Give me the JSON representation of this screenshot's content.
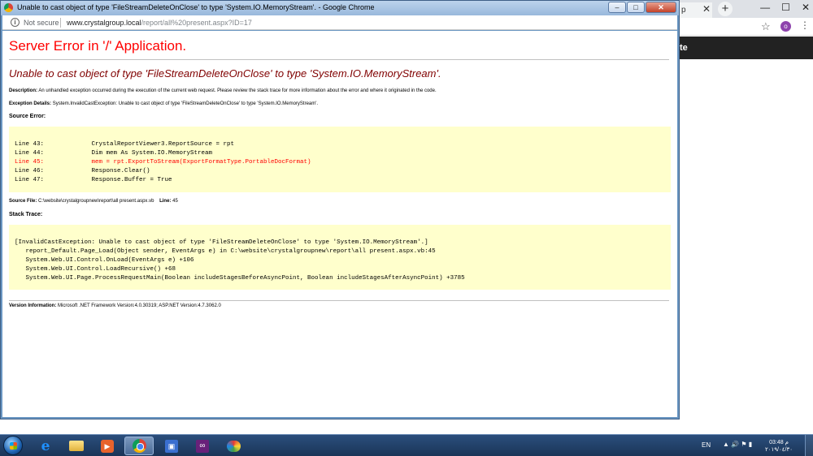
{
  "window": {
    "title": "Unable to cast object of type 'FileStreamDeleteOnClose' to type 'System.IO.MemoryStream'. - Google Chrome",
    "minimize_glyph": "–",
    "maximize_glyph": "□",
    "close_glyph": "✕"
  },
  "address_bar": {
    "security_label": "Not secure",
    "url_host": "www.crystalgroup.local",
    "url_path": "/report/all%20present.aspx?ID=17"
  },
  "background_window": {
    "tab_partial_text": "p",
    "dark_bar_text": "te",
    "profile_initial": "o"
  },
  "error_page": {
    "heading": "Server Error in '/' Application.",
    "subheading": "Unable to cast object of type 'FileStreamDeleteOnClose' to type 'System.IO.MemoryStream'.",
    "description_label": "Description:",
    "description_text": "An unhandled exception occurred during the execution of the current web request. Please review the stack trace for more information about the error and where it originated in the code.",
    "exception_label": "Exception Details:",
    "exception_text": "System.InvalidCastException: Unable to cast object of type 'FileStreamDeleteOnClose' to type 'System.IO.MemoryStream'.",
    "source_error_label": "Source Error:",
    "source_lines": [
      {
        "text": "Line 43:             CrystalReportViewer3.ReportSource = rpt",
        "highlight": false
      },
      {
        "text": "Line 44:             Dim mem As System.IO.MemoryStream",
        "highlight": false
      },
      {
        "text": "Line 45:             mem = rpt.ExportToStream(ExportFormatType.PortableDocFormat)",
        "highlight": true
      },
      {
        "text": "Line 46:             Response.Clear()",
        "highlight": false
      },
      {
        "text": "Line 47:             Response.Buffer = True",
        "highlight": false
      }
    ],
    "source_file_label": "Source File:",
    "source_file_value": "C:\\website\\crystalgroupnew\\report\\all present.aspx.vb",
    "line_label": "Line:",
    "line_value": "45",
    "stack_trace_label": "Stack Trace:",
    "stack_lines": [
      "[InvalidCastException: Unable to cast object of type 'FileStreamDeleteOnClose' to type 'System.IO.MemoryStream'.]",
      "   report_Default.Page_Load(Object sender, EventArgs e) in C:\\website\\crystalgroupnew\\report\\all present.aspx.vb:45",
      "   System.Web.UI.Control.OnLoad(EventArgs e) +106",
      "   System.Web.UI.Control.LoadRecursive() +68",
      "   System.Web.UI.Page.ProcessRequestMain(Boolean includeStagesBeforeAsyncPoint, Boolean includeStagesAfterAsyncPoint) +3785"
    ],
    "version_label": "Version Information:",
    "version_text": "Microsoft .NET Framework Version:4.0.30319; ASP.NET Version:4.7.3062.0"
  },
  "taskbar": {
    "language": "EN",
    "time": "03:48 م",
    "date": "٢٠١٩/٠٤/٣٠",
    "tray_icons": "▲ 🔊 ⚑ ▮",
    "apps": [
      "internet-explorer",
      "file-explorer",
      "media-player",
      "google-chrome",
      "app-window",
      "visual-studio",
      "paint"
    ],
    "active_app": "google-chrome"
  }
}
